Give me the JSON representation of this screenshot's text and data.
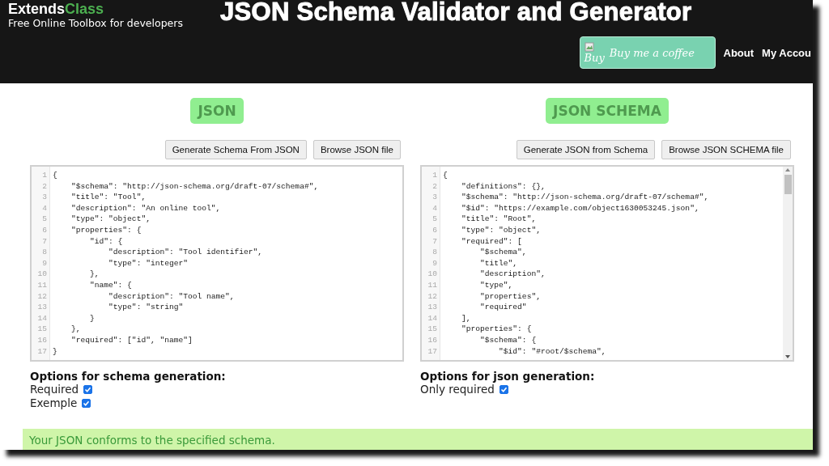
{
  "header": {
    "logo": {
      "main": "Extends",
      "accent": "Class"
    },
    "tagline": "Free Online Toolbox for developers",
    "title": "JSON Schema Validator and Generator",
    "coffee": {
      "alt": "Buy",
      "label": "Buy me a coffee"
    },
    "nav": [
      "About",
      "My Accou"
    ]
  },
  "panels": [
    {
      "heading": "JSON",
      "buttons": [
        "Generate Schema From JSON",
        "Browse JSON file"
      ],
      "scrollbar": false,
      "lines": [
        {
          "n": "1",
          "code": "{"
        },
        {
          "n": "2",
          "code": "    \"$schema\": \"http://json-schema.org/draft-07/schema#\","
        },
        {
          "n": "3",
          "code": "    \"title\": \"Tool\","
        },
        {
          "n": "4",
          "code": "    \"description\": \"An online tool\","
        },
        {
          "n": "5",
          "code": "    \"type\": \"object\","
        },
        {
          "n": "6",
          "code": "    \"properties\": {"
        },
        {
          "n": "7",
          "code": "        \"id\": {"
        },
        {
          "n": "8",
          "code": "            \"description\": \"Tool identifier\","
        },
        {
          "n": "9",
          "code": "            \"type\": \"integer\""
        },
        {
          "n": "10",
          "code": "        },"
        },
        {
          "n": "11",
          "code": "        \"name\": {"
        },
        {
          "n": "12",
          "code": "            \"description\": \"Tool name\","
        },
        {
          "n": "13",
          "code": "            \"type\": \"string\""
        },
        {
          "n": "14",
          "code": "        }"
        },
        {
          "n": "15",
          "code": "    },"
        },
        {
          "n": "16",
          "code": "    \"required\": [\"id\", \"name\"]"
        },
        {
          "n": "17",
          "code": "}"
        }
      ],
      "options_title": "Options for schema generation:",
      "options": [
        {
          "label": "Required",
          "checked": true
        },
        {
          "label": "Exemple",
          "checked": true
        }
      ]
    },
    {
      "heading": "JSON SCHEMA",
      "buttons": [
        "Generate JSON from Schema",
        "Browse JSON SCHEMA file"
      ],
      "scrollbar": true,
      "lines": [
        {
          "n": "1",
          "code": "{"
        },
        {
          "n": "2",
          "code": "    \"definitions\": {},"
        },
        {
          "n": "3",
          "code": "    \"$schema\": \"http://json-schema.org/draft-07/schema#\","
        },
        {
          "n": "4",
          "code": "    \"$id\": \"https://example.com/object1630053245.json\","
        },
        {
          "n": "5",
          "code": "    \"title\": \"Root\","
        },
        {
          "n": "6",
          "code": "    \"type\": \"object\","
        },
        {
          "n": "7",
          "code": "    \"required\": ["
        },
        {
          "n": "8",
          "code": "        \"$schema\","
        },
        {
          "n": "9",
          "code": "        \"title\","
        },
        {
          "n": "10",
          "code": "        \"description\","
        },
        {
          "n": "11",
          "code": "        \"type\","
        },
        {
          "n": "12",
          "code": "        \"properties\","
        },
        {
          "n": "13",
          "code": "        \"required\""
        },
        {
          "n": "14",
          "code": "    ],"
        },
        {
          "n": "15",
          "code": "    \"properties\": {"
        },
        {
          "n": "16",
          "code": "        \"$schema\": {"
        },
        {
          "n": "17",
          "code": "            \"$id\": \"#root/$schema\","
        }
      ],
      "options_title": "Options for json generation:",
      "options": [
        {
          "label": "Only required",
          "checked": true
        }
      ]
    }
  ],
  "status": "Your JSON conforms to the specified schema."
}
